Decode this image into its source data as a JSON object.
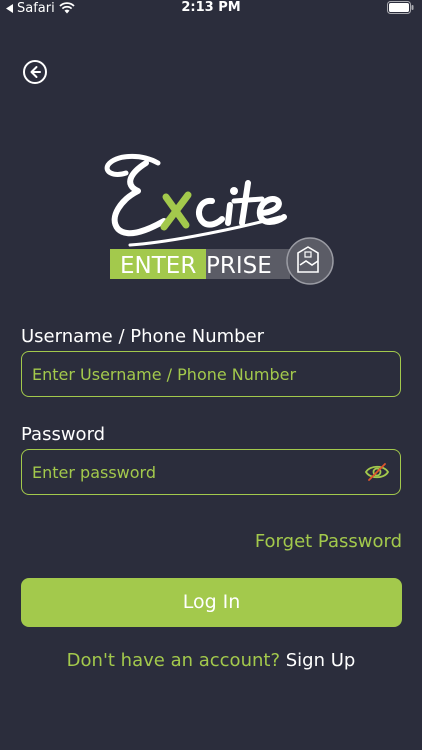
{
  "status_bar": {
    "back_app": "Safari",
    "time": "2:13 PM"
  },
  "logo": {
    "script_text": "Excite",
    "word_highlight": "ENTER",
    "word_rest": "PRISE"
  },
  "form": {
    "username_label": "Username / Phone Number",
    "username_placeholder": "Enter Username / Phone Number",
    "username_value": "",
    "password_label": "Password",
    "password_placeholder": "Enter password",
    "password_value": ""
  },
  "links": {
    "forgot_password": "Forget Password",
    "signup_prompt": "Don't have an account?",
    "signup_link": "Sign Up"
  },
  "buttons": {
    "login": "Log In"
  },
  "colors": {
    "background": "#2b2d3c",
    "accent": "#a3c94c",
    "text": "#ffffff"
  },
  "icons": {
    "back": "back-arrow-icon",
    "password_toggle": "eye-slash-icon",
    "wifi": "wifi-icon",
    "battery": "battery-icon"
  }
}
